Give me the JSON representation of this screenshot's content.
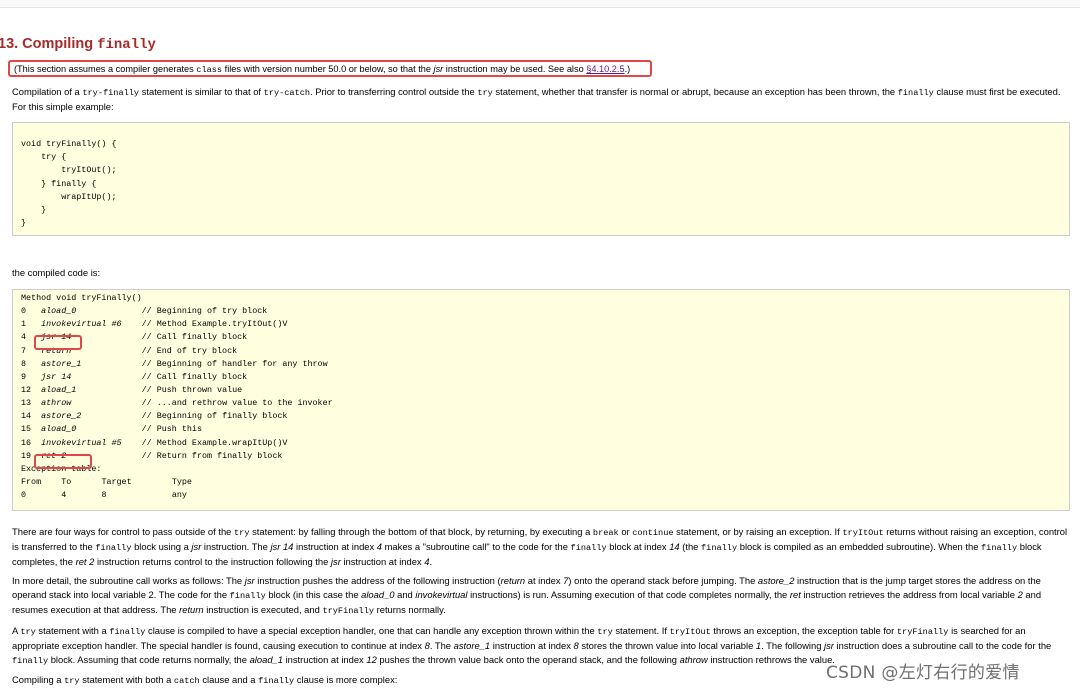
{
  "section": {
    "number": "13. Compiling ",
    "keyword": "finally"
  },
  "note": {
    "part1": "(This section assumes a compiler generates ",
    "code1": "class",
    "part2": " files with version number 50.0 or below, so that the ",
    "em1": "jsr",
    "part3": " instruction may be used. See also ",
    "link": "§4.10.2.5",
    "part4": ".)"
  },
  "intro": {
    "t1": "Compilation of a ",
    "c1": "try-finally",
    "t2": " statement is similar to that of ",
    "c2": "try-catch",
    "t3": ". Prior to transferring control outside the ",
    "c3": "try",
    "t4": " statement, whether that transfer is normal or abrupt, because an exception has been thrown, the ",
    "c4": "finally",
    "t5": " clause must first be executed. For this simple example:"
  },
  "example_code": [
    "",
    "void tryFinally() {",
    "    try {",
    "        tryItOut();",
    "    } finally {",
    "        wrapItUp();",
    "    }",
    "}",
    ""
  ],
  "compiled_label": "the compiled code is:",
  "compiled": {
    "header": "Method void tryFinally()",
    "rows": [
      {
        "idx": "0",
        "instr": "aload_0",
        "comment": "// Beginning of try block"
      },
      {
        "idx": "1",
        "instr": "invokevirtual #6",
        "comment": "// Method Example.tryItOut()V"
      },
      {
        "idx": "4",
        "instr": "jsr 14",
        "comment": "// Call finally block"
      },
      {
        "idx": "7",
        "instr": "return",
        "comment": "// End of try block"
      },
      {
        "idx": "8",
        "instr": "astore_1",
        "comment": "// Beginning of handler for any throw"
      },
      {
        "idx": "9",
        "instr": "jsr 14",
        "comment": "// Call finally block"
      },
      {
        "idx": "12",
        "instr": "aload_1",
        "comment": "// Push thrown value"
      },
      {
        "idx": "13",
        "instr": "athrow",
        "comment": "// ...and rethrow value to the invoker"
      },
      {
        "idx": "14",
        "instr": "astore_2",
        "comment": "// Beginning of finally block"
      },
      {
        "idx": "15",
        "instr": "aload_0",
        "comment": "// Push this"
      },
      {
        "idx": "16",
        "instr": "invokevirtual #5",
        "comment": "// Method Example.wrapItUp()V"
      },
      {
        "idx": "19",
        "instr": "ret 2",
        "comment": "// Return from finally block"
      }
    ],
    "exception_title": "Exception table:",
    "exception_header": [
      "From",
      "To",
      "Target",
      "Type"
    ],
    "exception_row": [
      "0",
      "4",
      "8",
      "any"
    ]
  },
  "p1": {
    "a": "There are four ways for control to pass outside of the ",
    "b": "try",
    "c": " statement: by falling through the bottom of that block, by returning, by executing a ",
    "d": "break",
    "e": " or ",
    "f": "continue",
    "g": " statement, or by raising an exception. If ",
    "h": "tryItOut",
    "i": " returns without raising an exception, control is transferred to the ",
    "j": "finally",
    "k": " block using a ",
    "l": "jsr",
    "m": " instruction. The ",
    "n": "jsr 14",
    "o": " instruction at index ",
    "p": "4",
    "q": " makes a \"subroutine call\" to the code for the ",
    "r": "finally",
    "s": " block at index ",
    "t": "14",
    "u": " (the ",
    "v": "finally",
    "w": " block is compiled as an embedded subroutine). When the ",
    "x": "finally",
    "y": " block completes, the ",
    "z": "ret 2",
    "aa": " instruction returns control to the instruction following the ",
    "ab": "jsr",
    "ac": " instruction at index ",
    "ad": "4",
    "ae": "."
  },
  "p2": {
    "a": "In more detail, the subroutine call works as follows: The ",
    "b": "jsr",
    "c": " instruction pushes the address of the following instruction (",
    "d": "return",
    "e": " at index ",
    "f": "7",
    "g": ") onto the operand stack before jumping. The ",
    "h": "astore_2",
    "i": " instruction that is the jump target stores the address on the operand stack into local variable 2. The code for the ",
    "j": "finally",
    "k": " block (in this case the ",
    "l": "aload_0",
    "m": " and ",
    "n": "invokevirtual",
    "o": " instructions) is run. Assuming execution of that code completes normally, the ",
    "p": "ret",
    "q": " instruction retrieves the address from local variable ",
    "r": "2",
    "s": " and resumes execution at that address. The ",
    "t": "return",
    "u": " instruction is executed, and ",
    "v": "tryFinally",
    "w": " returns normally."
  },
  "p3": {
    "a": "A ",
    "b": "try",
    "c": " statement with a ",
    "d": "finally",
    "e": " clause is compiled to have a special exception handler, one that can handle any exception thrown within the ",
    "f": "try",
    "g": " statement. If ",
    "h": "tryItOut",
    "i": " throws an exception, the exception table for ",
    "j": "tryFinally",
    "k": " is searched for an appropriate exception handler. The special handler is found, causing execution to continue at index ",
    "l": "8",
    "m": ". The ",
    "n": "astore_1",
    "o": " instruction at index ",
    "p": "8",
    "q": " stores the thrown value into local variable ",
    "r": "1",
    "s": ". The following ",
    "t": "jsr",
    "u": " instruction does a subroutine call to the code for the ",
    "v": "finally",
    "w": " block. Assuming that code returns normally, the ",
    "x": "aload_1",
    "y": " instruction at index ",
    "z": "12",
    "aa": " pushes the thrown value back onto the operand stack, and the following ",
    "ab": "athrow",
    "ac": " instruction rethrows the value."
  },
  "p4": {
    "a": "Compiling a ",
    "b": "try",
    "c": " statement with both a ",
    "d": "catch",
    "e": " clause and a ",
    "f": "finally",
    "g": " clause is more complex:"
  },
  "watermark": "CSDN @左灯右行的爱情",
  "colors": {
    "heading": "#a52a2a",
    "highlight": "#e04848",
    "code_bg": "#ffffe0",
    "link": "#551a8b"
  }
}
